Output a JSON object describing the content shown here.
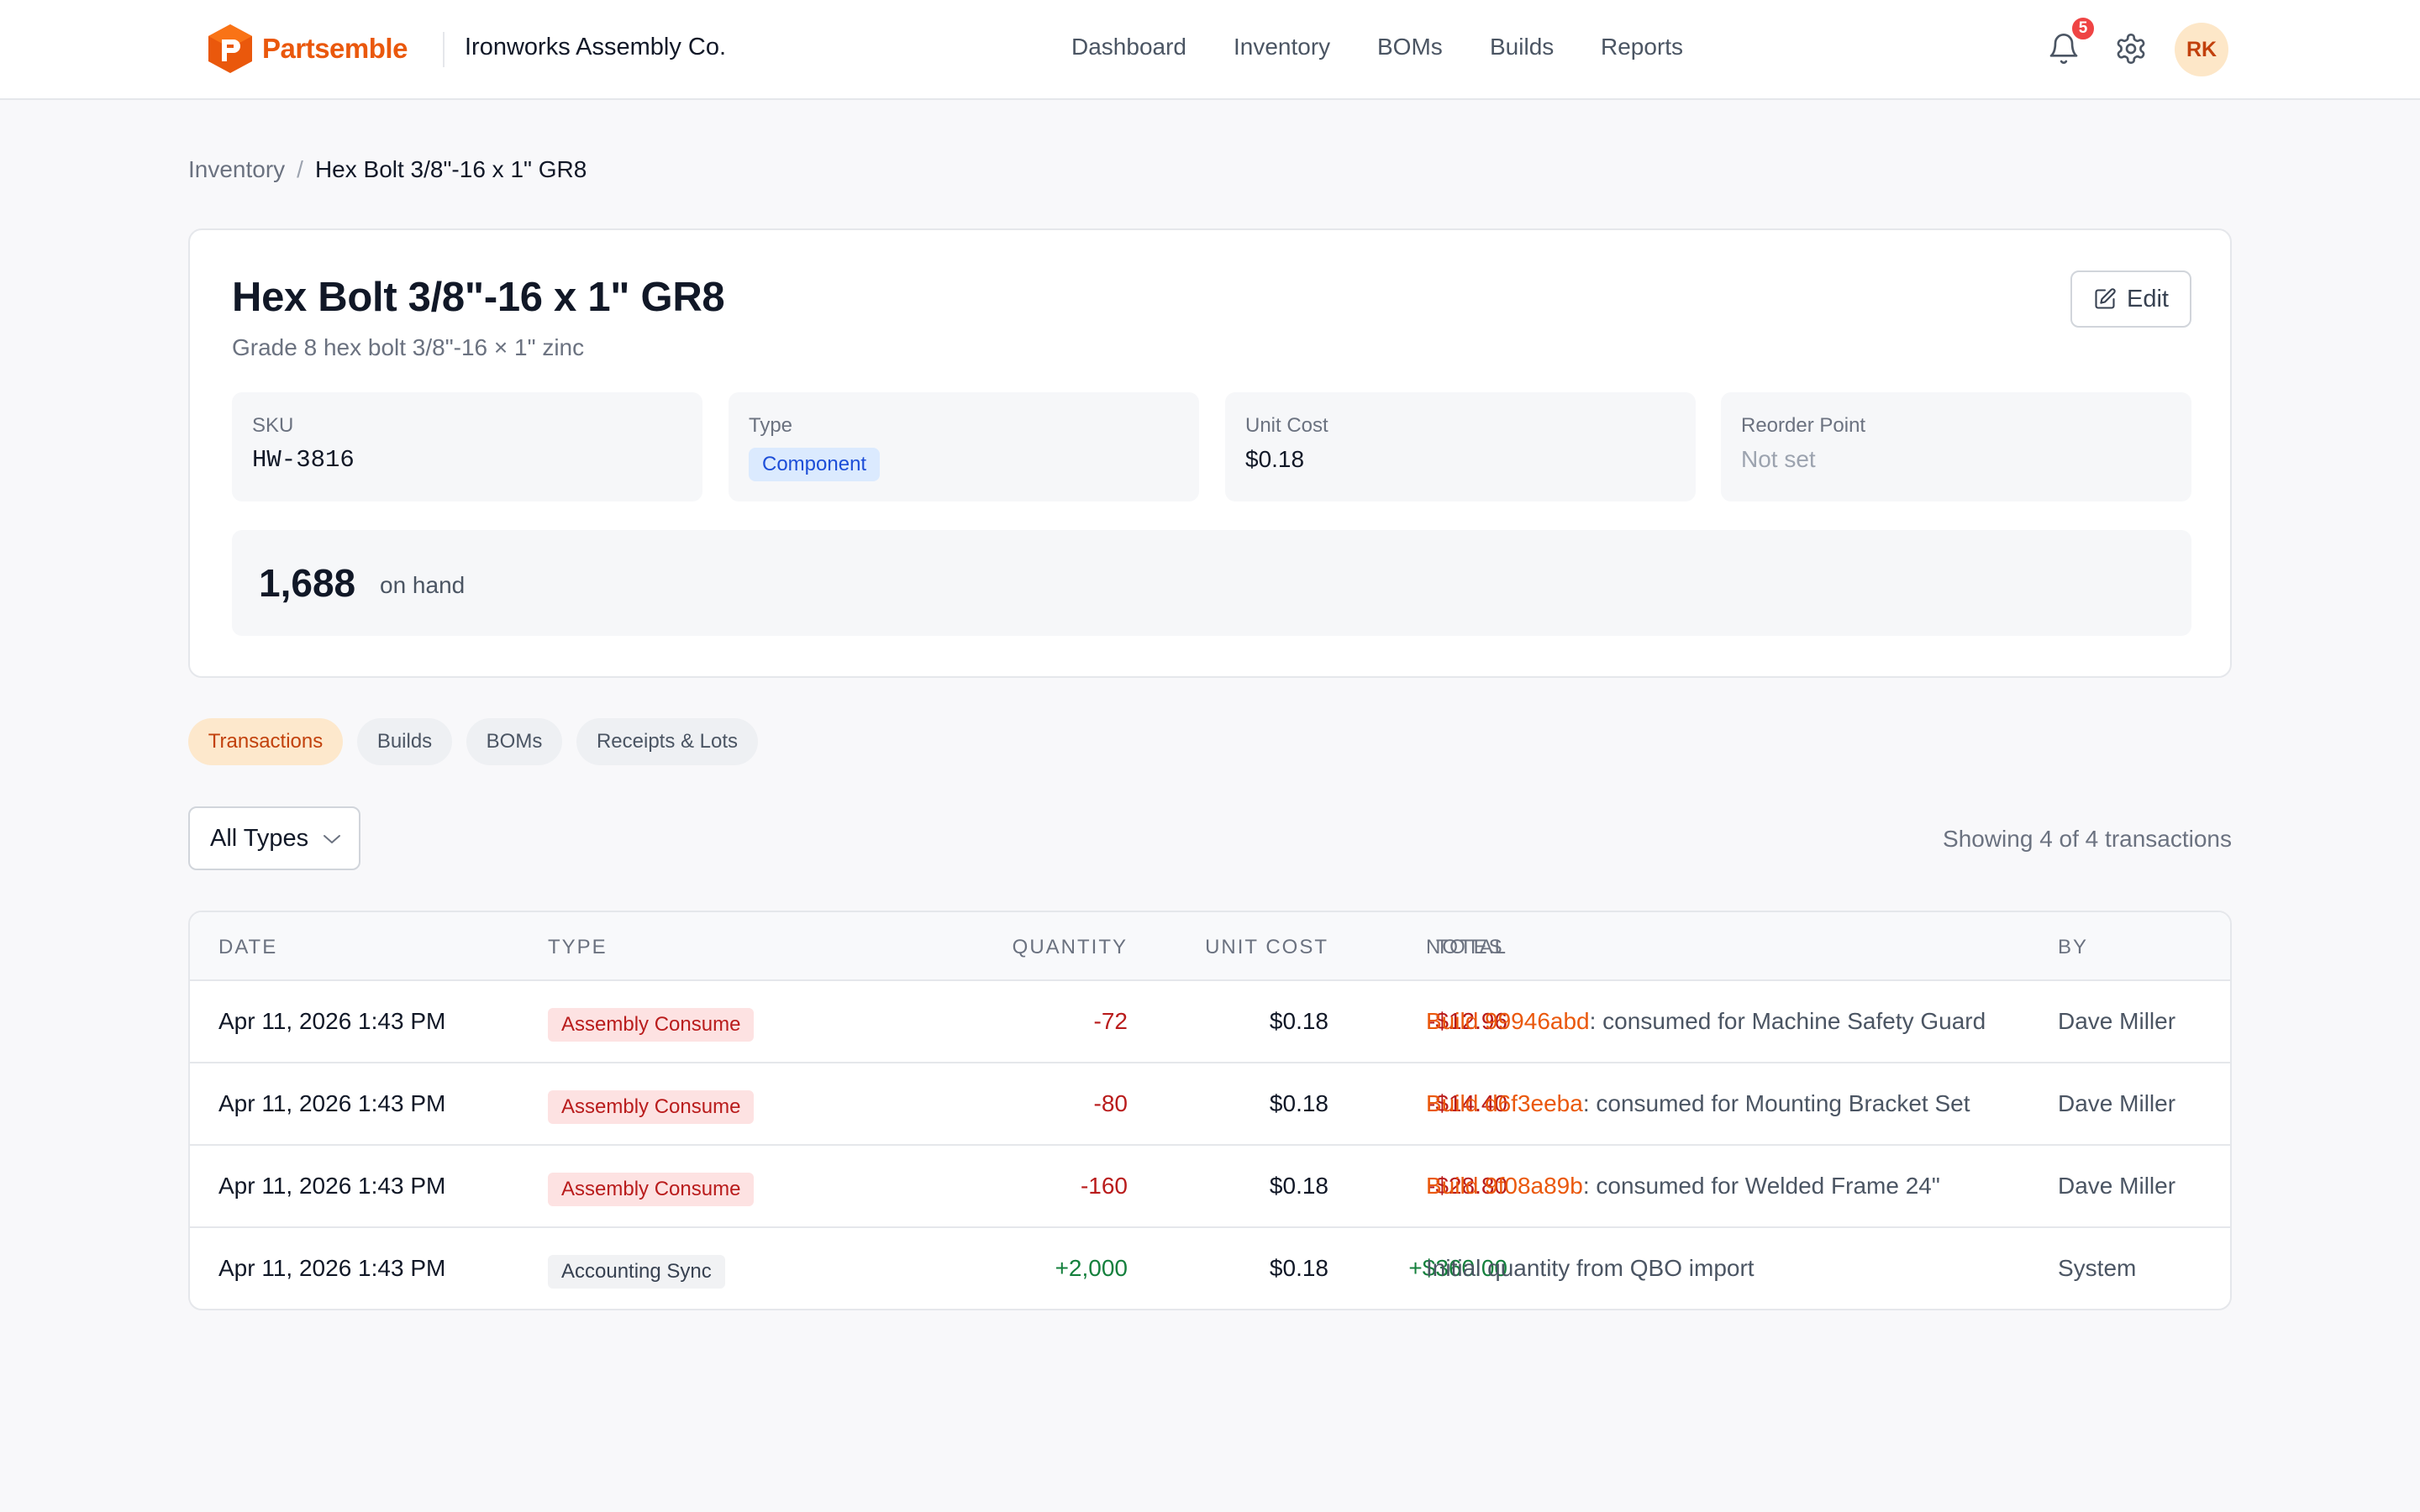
{
  "header": {
    "brand": "Partsemble",
    "org": "Ironworks Assembly Co.",
    "nav": [
      "Dashboard",
      "Inventory",
      "BOMs",
      "Builds",
      "Reports"
    ],
    "notifications_count": "5",
    "avatar_initials": "RK",
    "brand_color": "#ea580c"
  },
  "breadcrumb": {
    "parent": "Inventory",
    "separator": "/",
    "current": "Hex Bolt 3/8\"-16 x 1\" GR8"
  },
  "item": {
    "title": "Hex Bolt 3/8\"-16 x 1\" GR8",
    "description": "Grade 8 hex bolt 3/8\"-16 × 1\" zinc",
    "edit_label": "Edit",
    "fields": {
      "sku_label": "SKU",
      "sku": "HW-3816",
      "type_label": "Type",
      "type": "Component",
      "unit_cost_label": "Unit Cost",
      "unit_cost": "$0.18",
      "reorder_label": "Reorder Point",
      "reorder": "Not set"
    },
    "on_hand": "1,688",
    "on_hand_label": "on hand"
  },
  "tabs": [
    "Transactions",
    "Builds",
    "BOMs",
    "Receipts & Lots"
  ],
  "filter": {
    "selected": "All Types"
  },
  "showing": "Showing 4 of 4 transactions",
  "table": {
    "columns": [
      "Date",
      "Type",
      "Quantity",
      "Unit Cost",
      "Total",
      "Notes",
      "By"
    ],
    "rows": [
      {
        "date": "Apr 11, 2026 1:43 PM",
        "type": "Assembly Consume",
        "quantity": "-72",
        "unit_cost": "$0.18",
        "total": "-$12.96",
        "note_link": "Build 99946abd",
        "note_text": ": consumed for Machine Safety Guard",
        "by": "Dave Miller"
      },
      {
        "date": "Apr 11, 2026 1:43 PM",
        "type": "Assembly Consume",
        "quantity": "-80",
        "unit_cost": "$0.18",
        "total": "-$14.40",
        "note_link": "Build d6f3eeba",
        "note_text": ": consumed for Mounting Bracket Set",
        "by": "Dave Miller"
      },
      {
        "date": "Apr 11, 2026 1:43 PM",
        "type": "Assembly Consume",
        "quantity": "-160",
        "unit_cost": "$0.18",
        "total": "-$28.80",
        "note_link": "Build 9f08a89b",
        "note_text": ": consumed for Welded Frame 24\"",
        "by": "Dave Miller"
      },
      {
        "date": "Apr 11, 2026 1:43 PM",
        "type": "Accounting Sync",
        "quantity": "+2,000",
        "unit_cost": "$0.18",
        "total": "+$360.00",
        "note_link": "",
        "note_text": "Initial quantity from QBO import",
        "by": "System"
      }
    ]
  }
}
